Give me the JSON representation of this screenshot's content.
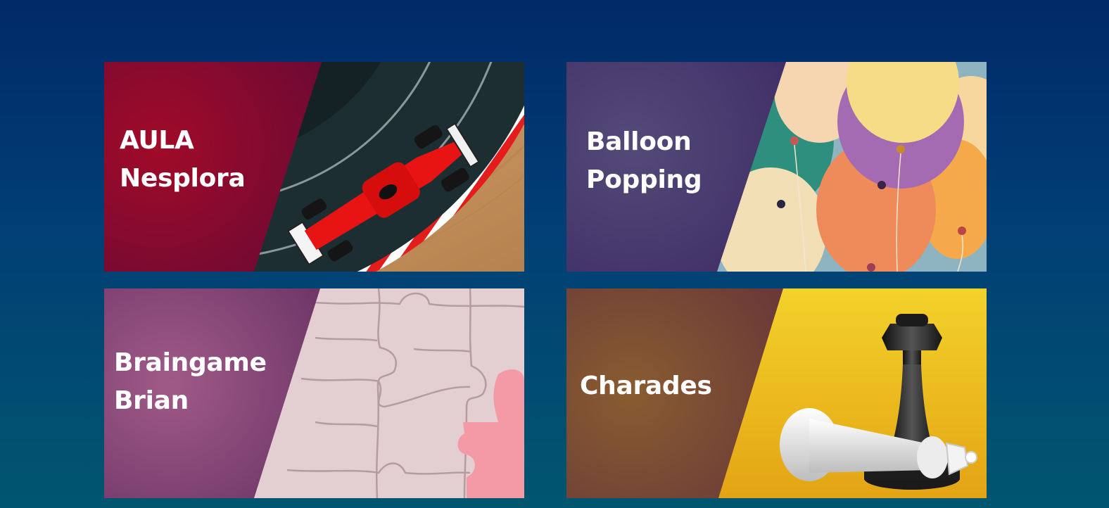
{
  "games": [
    {
      "id": "aula",
      "title_lines": [
        "AULA",
        "Nesplora"
      ],
      "image": "red-race-car-on-slot-track",
      "overlay_color": "#8a0a2c"
    },
    {
      "id": "balloon",
      "title_lines": [
        "Balloon",
        "Popping"
      ],
      "image": "colorful-balloons",
      "overlay_color": "#4a3f73"
    },
    {
      "id": "brain",
      "title_lines": [
        "Braingame",
        "Brian"
      ],
      "image": "jigsaw-puzzle-pieces",
      "overlay_color": "#8e4878"
    },
    {
      "id": "charades",
      "title_lines": [
        "Charades"
      ],
      "image": "chess-king-and-fallen-king",
      "overlay_color": "#7a4a36"
    }
  ]
}
